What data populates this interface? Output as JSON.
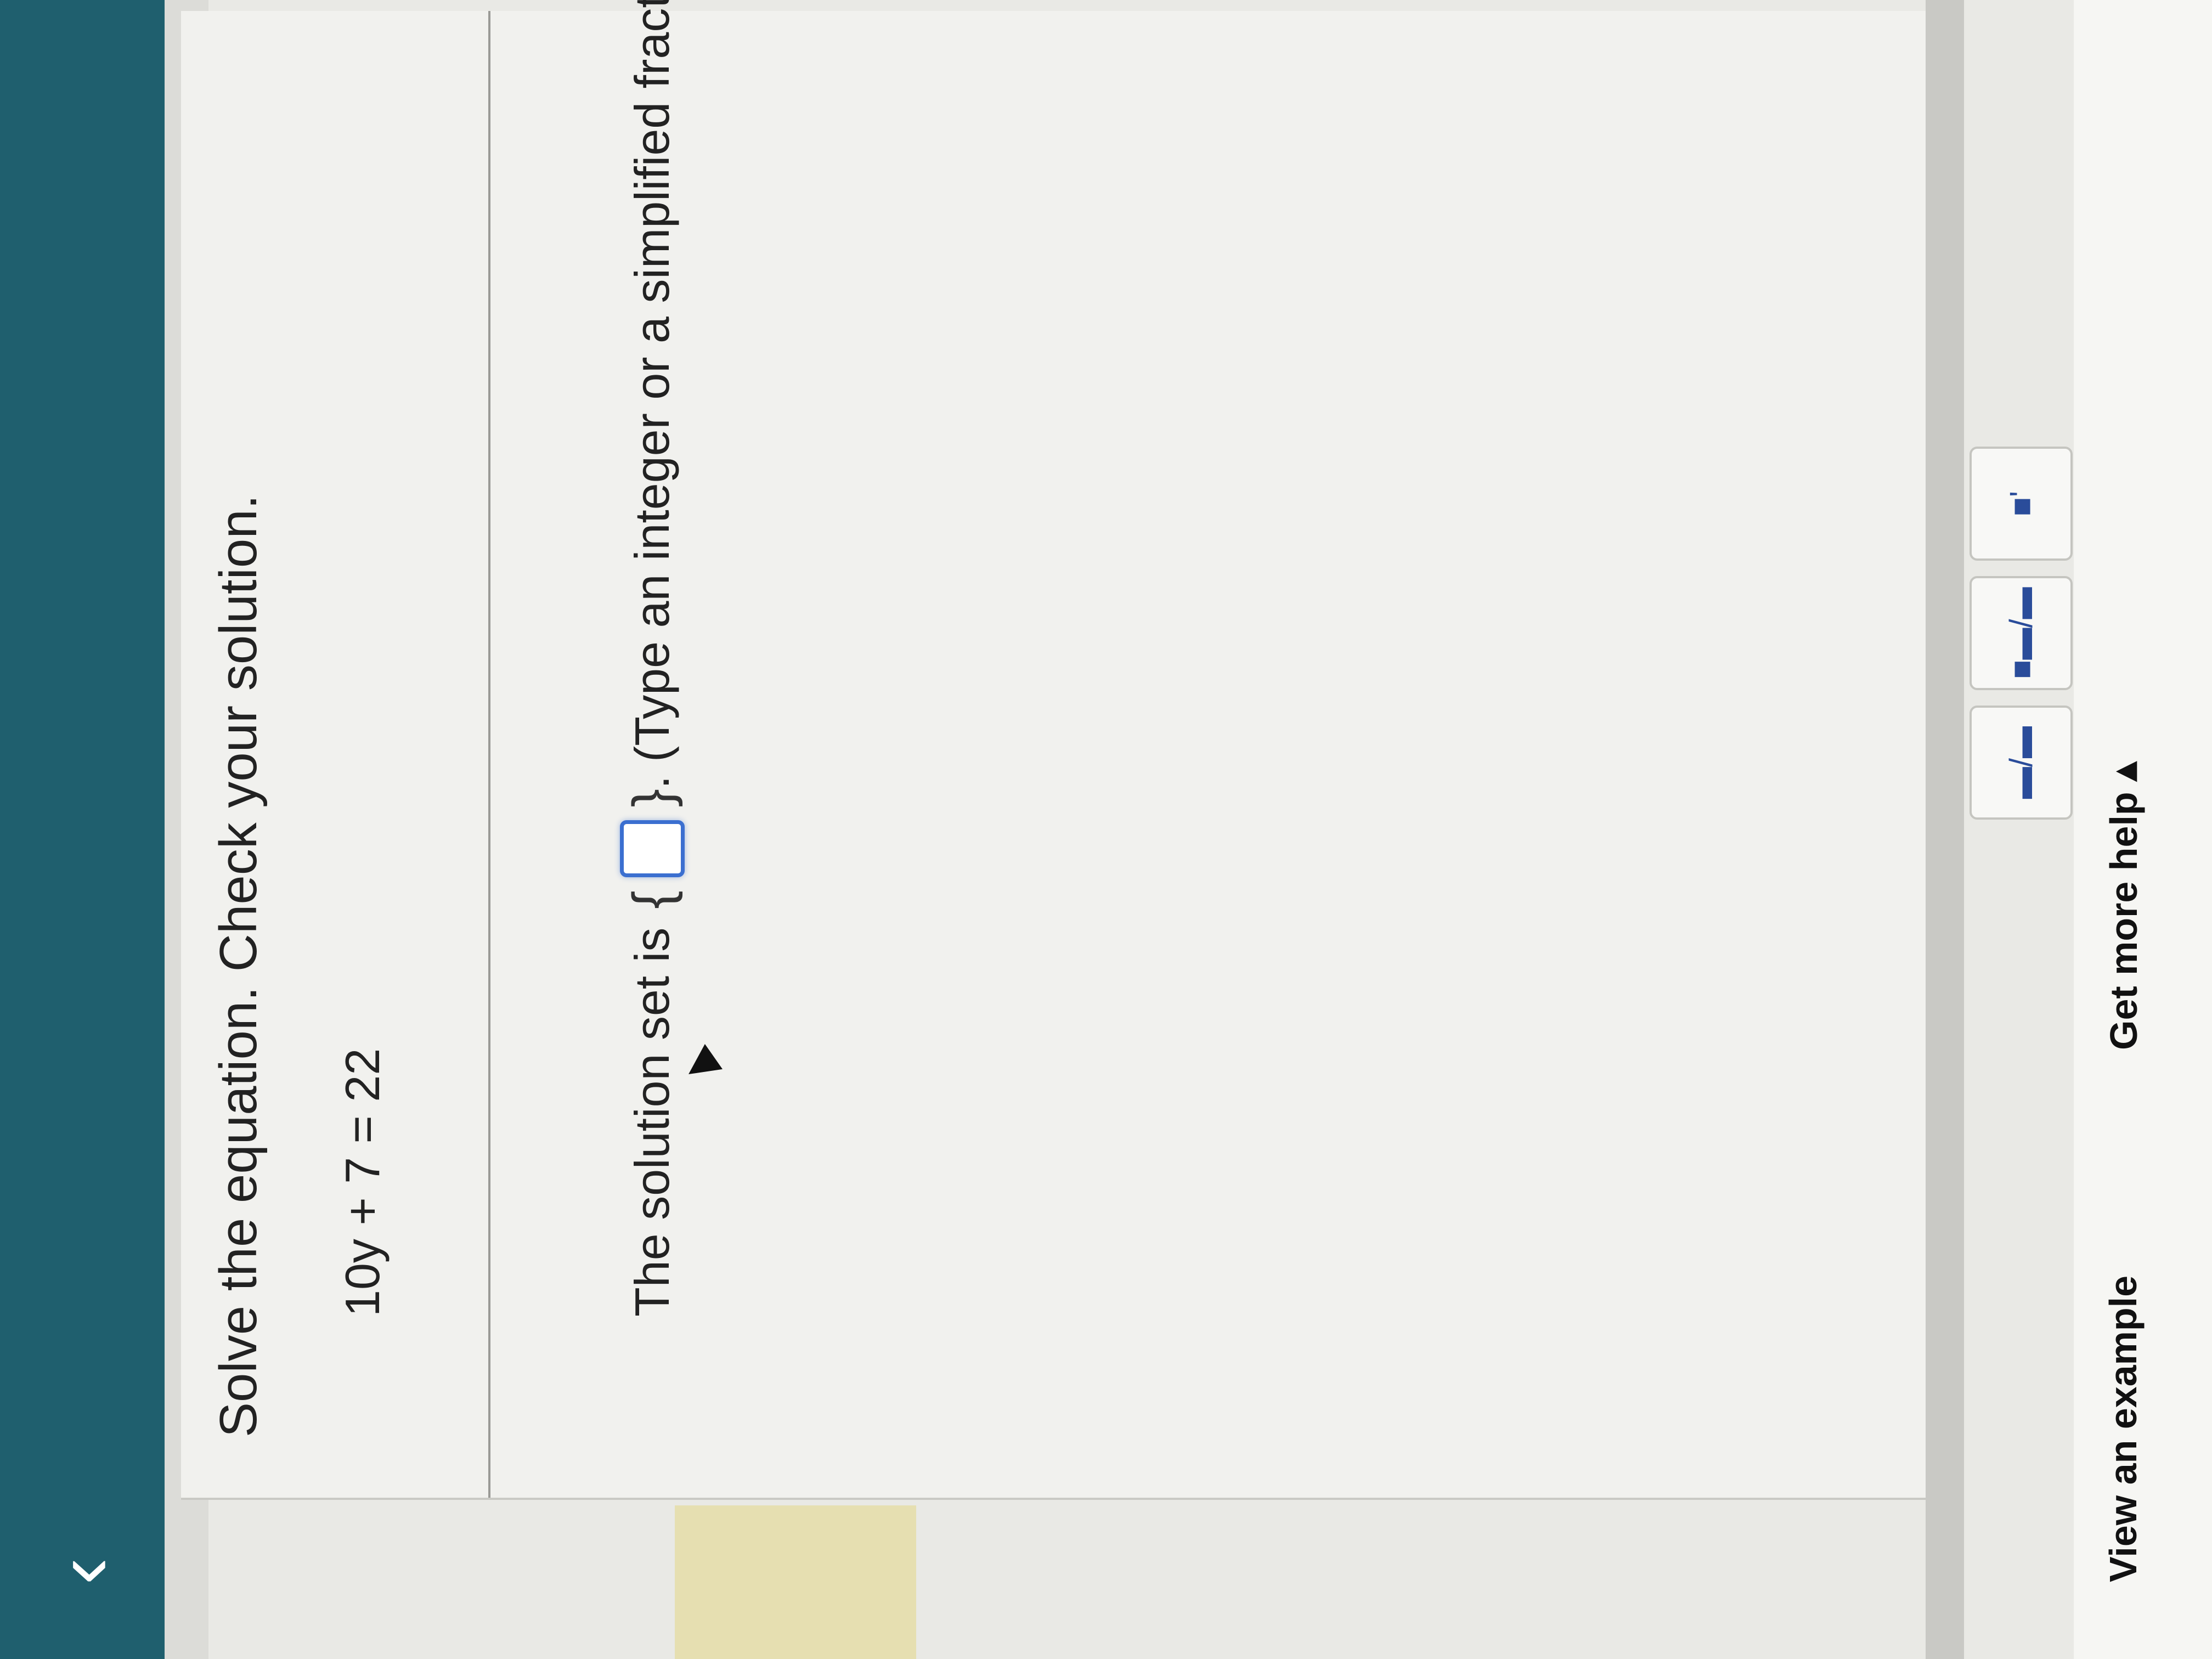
{
  "header": {
    "back_glyph": "‹"
  },
  "question": {
    "prompt": "Solve the equation. Check your solution.",
    "equation": "10y + 7 = 22",
    "answer_prefix": "The solution set is",
    "brace_open": "{",
    "brace_close": "}",
    "answer_value": "",
    "answer_suffix": ". (Type an integer or a simplified fraction.)"
  },
  "tools": [
    {
      "name": "fraction-tool",
      "glyph": "▬/▬"
    },
    {
      "name": "mixed-number-tool",
      "glyph": "■▬/▬"
    },
    {
      "name": "exponent-tool",
      "glyph": "■'"
    }
  ],
  "footer": {
    "view_example": "View an example",
    "get_more_help": "Get more help ▴"
  },
  "colors": {
    "topbar": "#1f5f6e",
    "answer_box_border": "#3b6fd0"
  }
}
